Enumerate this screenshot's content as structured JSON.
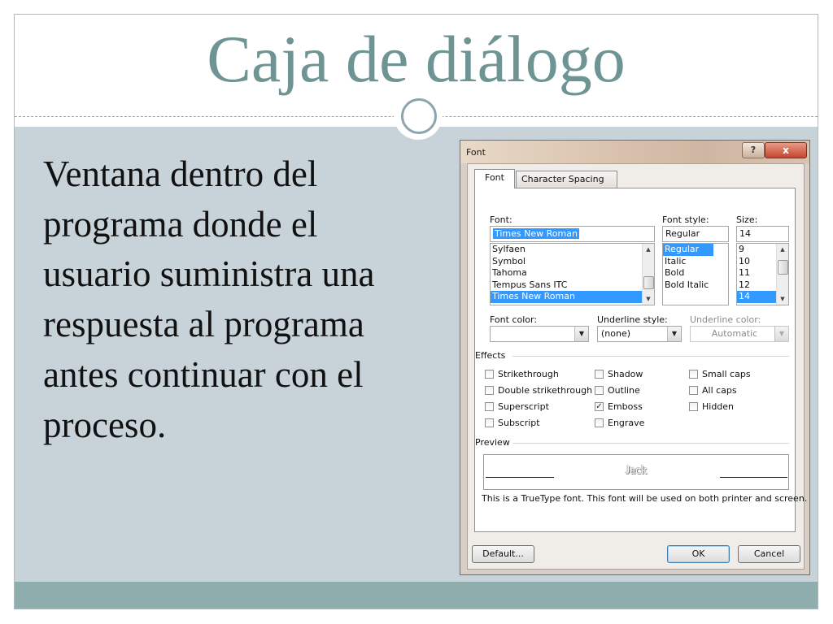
{
  "slide": {
    "title": "Caja de diálogo",
    "body": "Ventana dentro del programa donde el usuario suministra una respuesta al programa antes continuar con el proceso."
  },
  "dialog": {
    "title": "Font",
    "help": "?",
    "close": "x",
    "tabs": [
      {
        "label": "Font",
        "active": true
      },
      {
        "label": "Character Spacing",
        "active": false
      }
    ],
    "font_label": "Font:",
    "font_value": "Times New Roman",
    "font_list": [
      "Sylfaen",
      "Symbol",
      "Tahoma",
      "Tempus Sans ITC",
      "Times New Roman"
    ],
    "style_label": "Font style:",
    "style_value": "Regular",
    "style_list": [
      "Regular",
      "Italic",
      "Bold",
      "Bold Italic"
    ],
    "size_label": "Size:",
    "size_value": "14",
    "size_list": [
      "9",
      "10",
      "11",
      "12",
      "14"
    ],
    "font_color_label": "Font color:",
    "font_color_value": "",
    "underline_style_label": "Underline style:",
    "underline_style_value": "(none)",
    "underline_color_label": "Underline color:",
    "underline_color_value": "Automatic",
    "effects_label": "Effects",
    "effects": [
      {
        "label": "Strikethrough",
        "checked": false
      },
      {
        "label": "Double strikethrough",
        "checked": false
      },
      {
        "label": "Superscript",
        "checked": false
      },
      {
        "label": "Subscript",
        "checked": false
      },
      {
        "label": "Shadow",
        "checked": false
      },
      {
        "label": "Outline",
        "checked": false
      },
      {
        "label": "Emboss",
        "checked": true
      },
      {
        "label": "Engrave",
        "checked": false
      },
      {
        "label": "Small caps",
        "checked": false
      },
      {
        "label": "All caps",
        "checked": false
      },
      {
        "label": "Hidden",
        "checked": false
      }
    ],
    "preview_label": "Preview",
    "preview_text": "Jack",
    "preview_note": "This is a TrueType font. This font will be used on both printer and screen.",
    "buttons": {
      "default": "Default...",
      "ok": "OK",
      "cancel": "Cancel"
    }
  },
  "colors": {
    "title": "#6f9494",
    "body_bg": "#c7d3d8",
    "band": "#8fadad",
    "selection": "#3399ff"
  }
}
